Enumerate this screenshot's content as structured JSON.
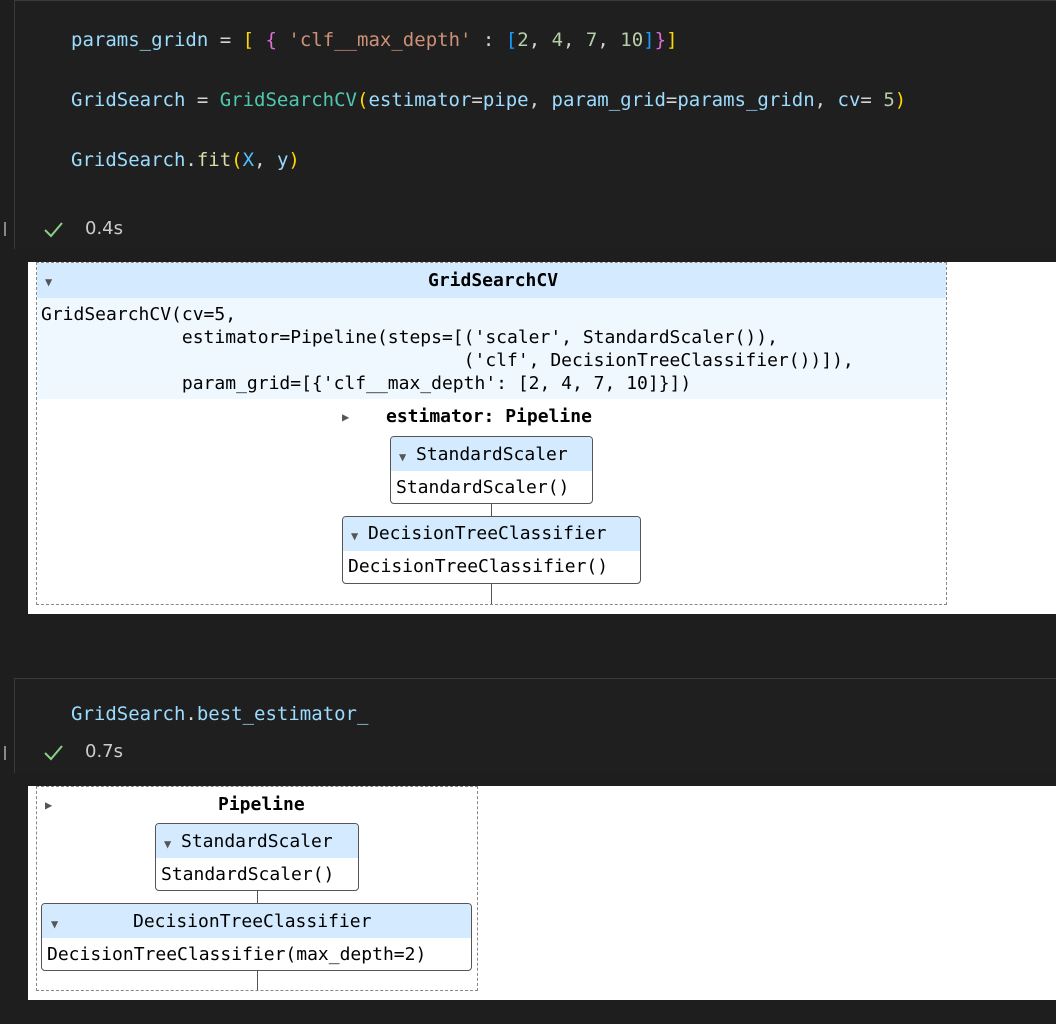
{
  "cell1": {
    "lines": [
      "params_gridn = [ { 'clf__max_depth' : [2, 4, 7, 10]}]",
      "GridSearch = GridSearchCV(estimator=pipe, param_grid=params_gridn, cv= 5)",
      "GridSearch.fit(X, y)"
    ],
    "tokens": {
      "l1_var": "params_gridn",
      "l1_eq": " = ",
      "l1_b1o": "[",
      "l1_sp1": " ",
      "l1_b2o": "{",
      "l1_sp2": " ",
      "l1_str": "'clf__max_depth'",
      "l1_colon": " : ",
      "l1_b3o": "[",
      "l1_n1": "2",
      "l1_c1": ", ",
      "l1_n2": "4",
      "l1_c2": ", ",
      "l1_n3": "7",
      "l1_c3": ", ",
      "l1_n4": "10",
      "l1_b3c": "]",
      "l1_b2c": "}",
      "l1_b1c": "]",
      "l2_var": "GridSearch",
      "l2_eq": " = ",
      "l2_cls": "GridSearchCV",
      "l2_po": "(",
      "l2_k1": "estimator",
      "l2_e1": "=",
      "l2_v1": "pipe",
      "l2_c1": ", ",
      "l2_k2": "param_grid",
      "l2_e2": "=",
      "l2_v2": "params_gridn",
      "l2_c2": ", ",
      "l2_k3": "cv",
      "l2_e3": "= ",
      "l2_n": "5",
      "l2_pc": ")",
      "l3_var": "GridSearch",
      "l3_dot": ".",
      "l3_fn": "fit",
      "l3_po": "(",
      "l3_x": "X",
      "l3_c": ", ",
      "l3_y": "y",
      "l3_pc": ")"
    },
    "exec_time": "0.4s"
  },
  "output1": {
    "title": "GridSearchCV",
    "repr_lines": [
      "GridSearchCV(cv=5,",
      "             estimator=Pipeline(steps=[('scaler', StandardScaler()),",
      "                                       ('clf', DecisionTreeClassifier())]),",
      "             param_grid=[{'clf__max_depth': [2, 4, 7, 10]}])"
    ],
    "estimator_label": "estimator: Pipeline",
    "scaler_title": "StandardScaler",
    "scaler_repr": "StandardScaler()",
    "tree_title": "DecisionTreeClassifier",
    "tree_repr": "DecisionTreeClassifier()"
  },
  "cell2": {
    "code_var": "GridSearch",
    "code_dot": ".",
    "code_attr": "best_estimator_",
    "exec_time": "0.7s"
  },
  "output2": {
    "title": "Pipeline",
    "scaler_title": "StandardScaler",
    "scaler_repr": "StandardScaler()",
    "tree_title": "DecisionTreeClassifier",
    "tree_repr": "DecisionTreeClassifier(max_depth=2)"
  },
  "icons": {
    "check": "check-icon",
    "expand_down": "triangle-down-icon",
    "expand_right": "triangle-right-icon"
  },
  "colors": {
    "editor_bg": "#1e1e1e",
    "header_blue": "#d4ebff",
    "repr_bg": "#f0f8ff",
    "check_green": "#89d185"
  }
}
